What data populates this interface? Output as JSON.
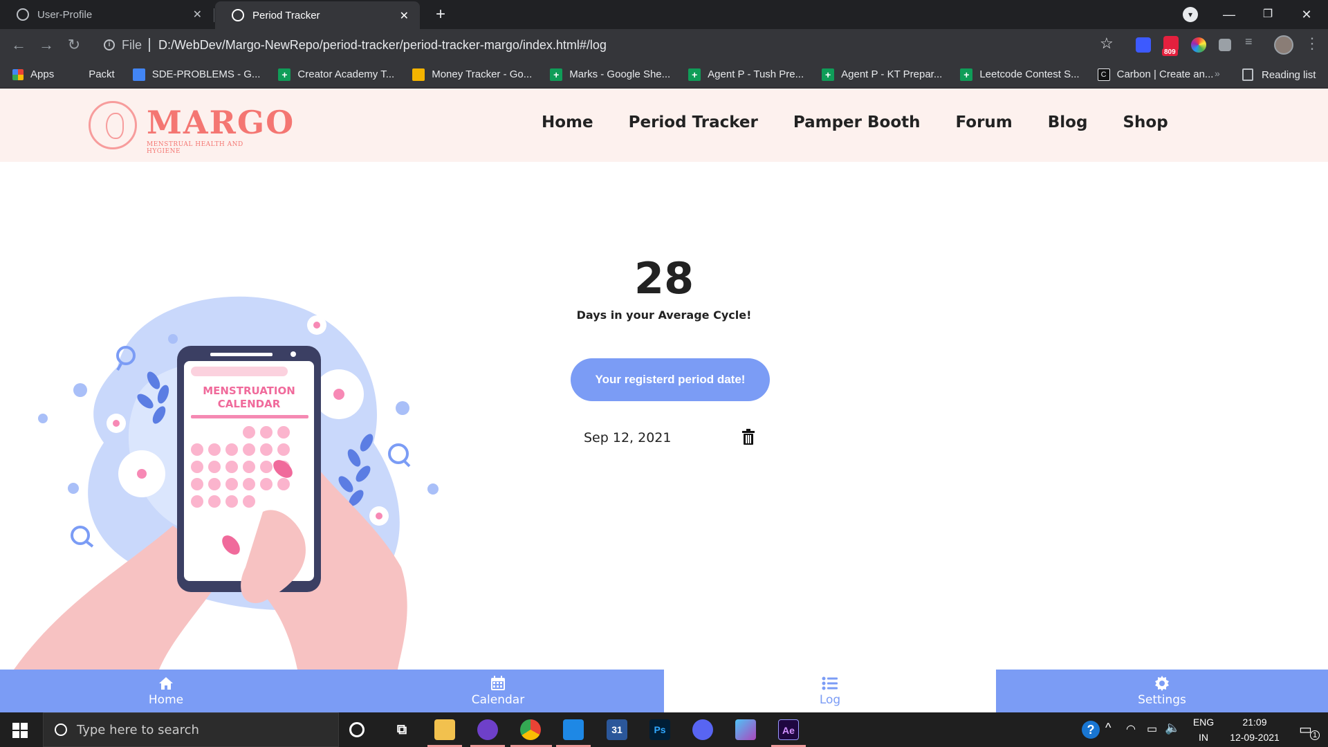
{
  "browser": {
    "tabs": [
      {
        "title": "User-Profile",
        "active": false
      },
      {
        "title": "Period Tracker",
        "active": true
      }
    ],
    "address": {
      "scheme_label": "File",
      "url": "D:/WebDev/Margo-NewRepo/period-tracker/period-tracker-margo/index.html#/log"
    },
    "extension_badge": "809",
    "bookmarks": [
      {
        "label": "Apps",
        "icon": "apps-icon"
      },
      {
        "label": "Packt",
        "icon": "none"
      },
      {
        "label": "SDE-PROBLEMS - G...",
        "icon": "docs-icon"
      },
      {
        "label": "Creator Academy T...",
        "icon": "sheets-icon"
      },
      {
        "label": "Money Tracker - Go...",
        "icon": "slides-icon"
      },
      {
        "label": "Marks - Google She...",
        "icon": "sheets-icon"
      },
      {
        "label": "Agent P - Tush Pre...",
        "icon": "sheets-icon"
      },
      {
        "label": "Agent P - KT Prepar...",
        "icon": "sheets-icon"
      },
      {
        "label": "Leetcode Contest S...",
        "icon": "sheets-icon"
      },
      {
        "label": "Carbon | Create an...",
        "icon": "carbon-icon"
      }
    ],
    "more_bookmarks": "»",
    "reading_list": "Reading list"
  },
  "site": {
    "logo": {
      "name": "MARGO",
      "tagline": "MENSTRUAL HEALTH AND HYGIENE"
    },
    "nav": [
      "Home",
      "Period Tracker",
      "Pamper Booth",
      "Forum",
      "Blog",
      "Shop"
    ],
    "illustration": {
      "title_line1": "MENSTRUATION",
      "title_line2": "CALENDAR"
    },
    "cycle": {
      "days": "28",
      "label": "Days in your Average Cycle!"
    },
    "registered_button": "Your registerd period date!",
    "period_entries": [
      {
        "date": "Sep 12, 2021"
      }
    ],
    "bottom_nav": [
      {
        "label": "Home",
        "icon": "home-icon",
        "active": false
      },
      {
        "label": "Calendar",
        "icon": "calendar-icon",
        "active": false
      },
      {
        "label": "Log",
        "icon": "list-icon",
        "active": true
      },
      {
        "label": "Settings",
        "icon": "gear-icon",
        "active": false
      }
    ],
    "colors": {
      "accent": "#7b9cf5",
      "brand": "#f47672",
      "header_bg": "#fdf1ee"
    }
  },
  "taskbar": {
    "search_placeholder": "Type here to search",
    "apps": [
      "Cortana",
      "Task View",
      "File Explorer",
      "GitHub Desktop",
      "Chrome",
      "VS Code",
      "Calendar",
      "Photoshop",
      "Discord",
      "Cube",
      "After Effects"
    ],
    "calendar_day": "31",
    "lang_top": "ENG",
    "lang_bottom": "IN",
    "time": "21:09",
    "date": "12-09-2021",
    "notification_count": "1"
  }
}
